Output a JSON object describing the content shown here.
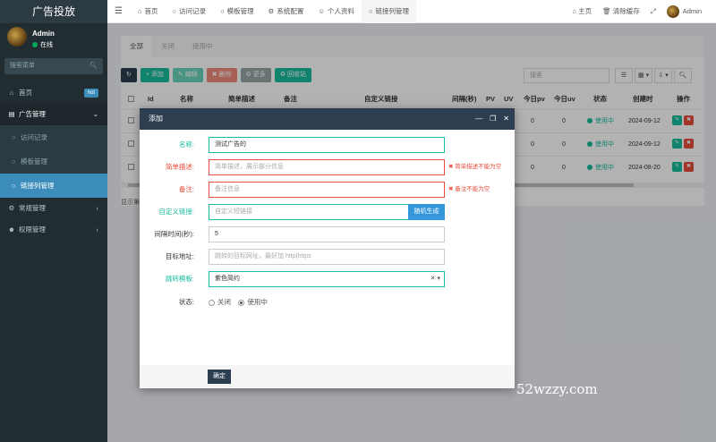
{
  "sidebar": {
    "brand": "广告投放",
    "user": {
      "name": "Admin",
      "status": "在线"
    },
    "search_placeholder": "搜索菜单",
    "items": [
      {
        "label": "首页",
        "badge": "hot"
      },
      {
        "label": "广告管理"
      },
      {
        "label": "访问记录"
      },
      {
        "label": "模板管理"
      },
      {
        "label": "链接列管理"
      },
      {
        "label": "常规管理"
      },
      {
        "label": "权限管理"
      }
    ]
  },
  "topbar": {
    "tabs": [
      "首页",
      "访问记录",
      "模板管理",
      "系统配置",
      "个人资料",
      "链接列管理"
    ],
    "right": {
      "home": "主页",
      "clear_cache": "清除缓存",
      "user": "Admin"
    }
  },
  "panel": {
    "tabs": [
      "全部",
      "关闭",
      "使用中"
    ],
    "toolbar": {
      "add": "添加",
      "edit": "编辑",
      "delete": "删除",
      "more": "更多",
      "recycle": "回收站"
    },
    "search_placeholder": "搜索",
    "columns": [
      "Id",
      "名称",
      "简单描述",
      "备注",
      "自定义链接",
      "间隔(秒)",
      "PV",
      "UV",
      "今日pv",
      "今日uv",
      "状态",
      "创建时",
      "操作"
    ],
    "rows": [
      {
        "pv_today": "0",
        "uv_today": "0",
        "status": "使用中",
        "created": "2024-09-12"
      },
      {
        "pv_today": "0",
        "uv_today": "0",
        "status": "使用中",
        "created": "2024-09-12"
      },
      {
        "pv_today": "0",
        "uv_today": "0",
        "status": "使用中",
        "created": "2024-08-20"
      }
    ],
    "footer": "显示第"
  },
  "modal": {
    "title": "添加",
    "fields": {
      "name": {
        "label": "名称:",
        "value": "测试广告的"
      },
      "desc": {
        "label": "简单描述:",
        "placeholder": "简单描述，展示部分信息",
        "error": "简单描述不能为空"
      },
      "remark": {
        "label": "备注:",
        "placeholder": "备注信息",
        "error": "备注不能为空"
      },
      "link": {
        "label": "自定义链接:",
        "placeholder": "自定义短链接",
        "button": "随机生成"
      },
      "interval": {
        "label": "间隔时间(秒):",
        "value": "5"
      },
      "target": {
        "label": "目标地址:",
        "placeholder": "跳转的目标网址，最好加 http|https"
      },
      "template": {
        "label": "跳转模板:",
        "value": "紫色简约"
      },
      "status": {
        "label": "状态:",
        "options": [
          "关闭",
          "使用中"
        ]
      }
    },
    "confirm": "确定"
  },
  "watermark": "52wzzy.com"
}
